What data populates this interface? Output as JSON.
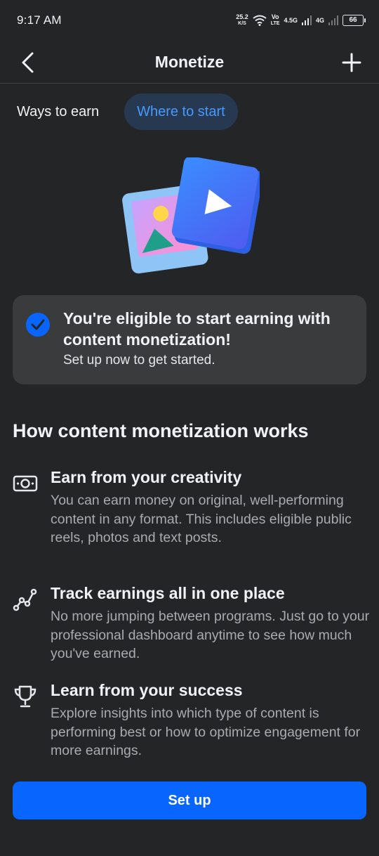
{
  "status_bar": {
    "time": "9:17 AM",
    "speed_value": "25.2",
    "speed_unit": "K/S",
    "volte_top": "Vo",
    "volte_bottom": "LTE",
    "net1": "4.5G",
    "net2": "4G",
    "battery": "66"
  },
  "header": {
    "title": "Monetize"
  },
  "tabs": [
    {
      "label": "Ways to earn",
      "active": false
    },
    {
      "label": "Where to start",
      "active": true
    }
  ],
  "eligible": {
    "title": "You're eligible to start earning with content monetization!",
    "subtitle": "Set up now to get started."
  },
  "section": {
    "title": "How content monetization works"
  },
  "features": [
    {
      "icon": "money-icon",
      "title": "Earn from your creativity",
      "description": "You can earn money on original, well-performing content in any format. This includes eligible public reels, photos and text posts."
    },
    {
      "icon": "chart-line-icon",
      "title": "Track earnings all in one place",
      "description": "No more jumping between programs. Just go to your professional dashboard anytime to see how much you've earned."
    },
    {
      "icon": "trophy-icon",
      "title": "Learn from your success",
      "description": "Explore insights into which type of content is performing best or how to optimize engagement for more earnings."
    }
  ],
  "cta": {
    "label": "Set up"
  },
  "colors": {
    "background": "#242526",
    "card": "#3a3b3c",
    "accent": "#0866ff",
    "tab_active_bg": "#263951",
    "tab_active_text": "#4599ff"
  }
}
